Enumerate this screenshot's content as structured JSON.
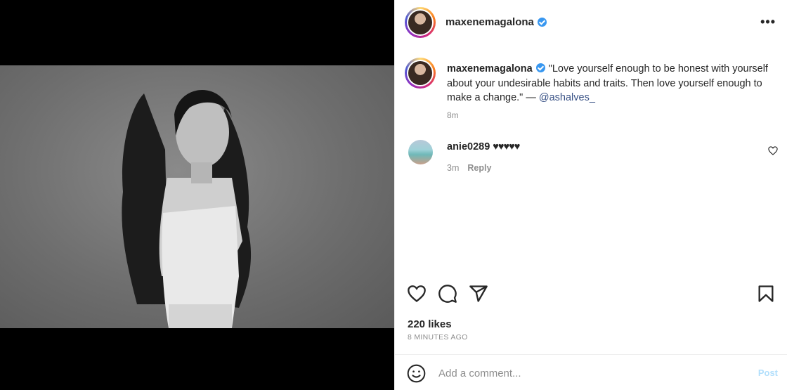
{
  "post": {
    "username": "maxenemagalona",
    "more_icon": "•••"
  },
  "caption": {
    "username": "maxenemagalona",
    "text": "\"Love yourself enough to be honest with yourself about your undesirable habits and traits. Then love yourself enough to make a change.\" — ",
    "mention": "@ashalves_",
    "time": "8m"
  },
  "comments": [
    {
      "username": "anie0289",
      "text": "♥♥♥♥♥",
      "time": "3m",
      "reply_label": "Reply"
    }
  ],
  "likes": "220 likes",
  "time_ago": "8 MINUTES AGO",
  "add_comment": {
    "placeholder": "Add a comment...",
    "post_label": "Post"
  },
  "colors": {
    "verified": "#3897f0",
    "mention": "#385185",
    "post_disabled": "#b2dffc"
  }
}
